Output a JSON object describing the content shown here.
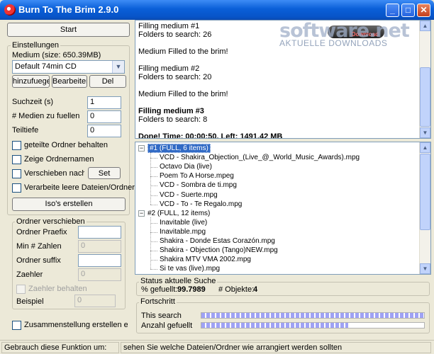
{
  "window": {
    "title": "Burn To The Brim 2.9.0",
    "minimize": "_",
    "maximize": "□",
    "close": "✕"
  },
  "watermark": {
    "brand": "software.net",
    "tagline": "AKTUELLE DOWNLOADS",
    "badge": "Download"
  },
  "left": {
    "start_label": "Start",
    "settings": {
      "title": "Einstellungen",
      "medium_label": "Medium (size: 650.39MB)",
      "medium_value": "Default 74min CD",
      "add_label": "hinzufuegen",
      "edit_label": "Bearbeiten",
      "delete_label": "Del",
      "search_time_label": "Suchzeit (s)",
      "search_time_value": "1",
      "media_count_label": "# Medien zu fuellen",
      "media_count_value": "0",
      "depth_label": "Teiltiefe",
      "depth_value": "0",
      "split_folders_label": "geteilte Ordner behalten",
      "show_names_label": "Zeige Ordnernamen",
      "move_label": "Verschieben nach Ord",
      "set_label": "Set",
      "empty_files_label": "Verarbeite leere Dateien/Ordner",
      "iso_label": "Iso's erstellen"
    },
    "move": {
      "title": "Ordner verschieben",
      "prefix_label": "Ordner Praefix",
      "prefix_value": "",
      "min_label": "Min # Zahlen",
      "min_value": "0",
      "suffix_label": "Ordner suffix",
      "suffix_value": "",
      "counter_label": "Zaehler",
      "counter_value": "0",
      "keep_counter_label": "Zaehler behalten",
      "example_label": "Beispiel",
      "example_value": "0"
    },
    "summary_label": "Zusammenstellung erstellen ermoegli"
  },
  "log": {
    "lines": [
      {
        "text": "Filling medium #1",
        "bold": false
      },
      {
        "text": "Folders to search: 26",
        "bold": false
      },
      {
        "text": "",
        "bold": false
      },
      {
        "text": "Medium Filled to the brim!",
        "bold": false
      },
      {
        "text": "",
        "bold": false
      },
      {
        "text": "Filling medium #2",
        "bold": false
      },
      {
        "text": "Folders to search: 20",
        "bold": false
      },
      {
        "text": "",
        "bold": false
      },
      {
        "text": "Medium Filled to the brim!",
        "bold": false
      },
      {
        "text": "",
        "bold": false
      },
      {
        "text": "Filling medium #3",
        "bold": true
      },
      {
        "text": "Folders to search: 8",
        "bold": false
      },
      {
        "text": "",
        "bold": false
      },
      {
        "text": "Done! Time: 00:00:50. Left: 1491.42 MB",
        "bold": true
      }
    ]
  },
  "tree": {
    "groups": [
      {
        "label": "#1 (FULL, 6 items)",
        "items": [
          "VCD - Shakira_Objection_(Live_@_World_Music_Awards).mpg",
          "Octavo Dia (live)",
          "Poem To A Horse.mpeg",
          "VCD - Sombra de ti.mpg",
          "VCD - Suerte.mpg",
          "VCD - To - Te Regalo.mpg"
        ]
      },
      {
        "label": "#2 (FULL, 12 items)",
        "items": [
          "Inavitable (live)",
          "Inavitable.mpg",
          "Shakira - Donde Estas Corazón.mpg",
          "Shakira - Objection (Tango)NEW.mpg",
          "Shakira MTV VMA 2002.mpg",
          "Si te vas (live).mpg"
        ]
      }
    ]
  },
  "status_search": {
    "title": "Status aktuelle Suche",
    "filled_label": "% gefuellt:",
    "filled_value": "99.7989",
    "objects_label": "# Objekte:",
    "objects_value": "4"
  },
  "progress": {
    "title": "Fortschritt",
    "this_search_label": "This search",
    "this_search_fraction": 1.0,
    "count_label": "Anzahl gefuellt",
    "count_fraction": 0.66
  },
  "statusbar": {
    "left": "Gebrauch diese Funktion um:",
    "right": "sehen Sie welche Dateien/Ordner wie arrangiert werden sollten"
  }
}
